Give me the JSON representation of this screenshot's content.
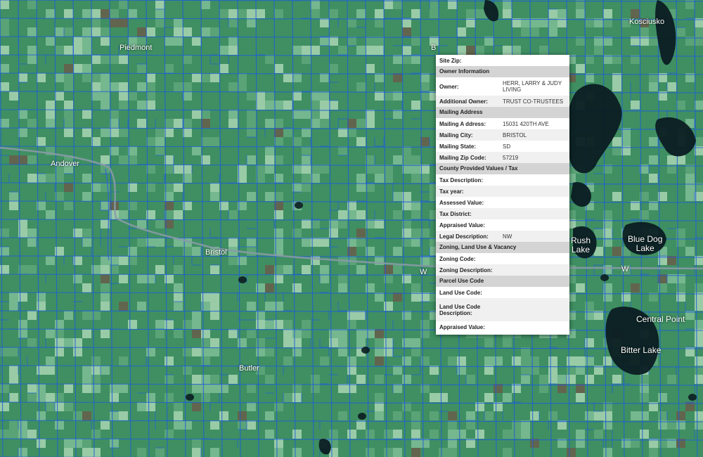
{
  "map": {
    "colors": {
      "land": "#3f8f62",
      "field_light": "#7fbe96",
      "parcel_line": "#1e5fd6",
      "water": "#0b1d22",
      "road": "#8a9aa8"
    },
    "places": {
      "piedmont": "Piedmont",
      "andover": "Andover",
      "bristol": "Bristol",
      "butler": "Butler",
      "kosciusko": "Kosciusko",
      "central_point": "Central Point",
      "w_label": "W",
      "b_label": "B"
    },
    "lakes": {
      "rush_lake_1": "Rush",
      "rush_lake_2": "Lake",
      "blue_dog_1": "Blue Dog",
      "blue_dog_2": "Lake",
      "bitter_lake": "Bitter Lake"
    }
  },
  "popup": {
    "site_zip_label": "Site Zip:",
    "site_zip_value": "",
    "owner_section": "Owner Information",
    "owner_label": "Owner:",
    "owner_value": "HERR, LARRY & JUDY LIVING",
    "add_owner_label": "Additional Owner:",
    "add_owner_value": "TRUST CO-TRUSTEES",
    "mailing_section": "Mailing Address",
    "mail_addr_label": "Mailing A ddress:",
    "mail_addr_value": "15031 420TH AVE",
    "mail_city_label": "Mailing City:",
    "mail_city_value": "BRISTOL",
    "mail_state_label": "Mailing State:",
    "mail_state_value": "SD",
    "mail_zip_label": "Mailing Zip Code:",
    "mail_zip_value": "57219",
    "county_section": "County Provided Values / Tax",
    "tax_desc_label": "Tax Description:",
    "tax_year_label": "Tax year:",
    "assessed_label": "Assessed Value:",
    "tax_district_label": "Tax District:",
    "appraised_label": "Appraised Value:",
    "legal_desc_label": "Legal Description:",
    "legal_desc_value": "NW",
    "zoning_section": "Zoning, Land Use & Vacancy",
    "zoning_code_label": "Zoning Code:",
    "zoning_desc_label": "Zoning Description:",
    "parcel_section": "Parcel Use Code",
    "land_use_code_label": "Land Use Code:",
    "land_use_desc_label": "Land Use Code Description:",
    "appraised2_label": "Appraised Value:"
  }
}
